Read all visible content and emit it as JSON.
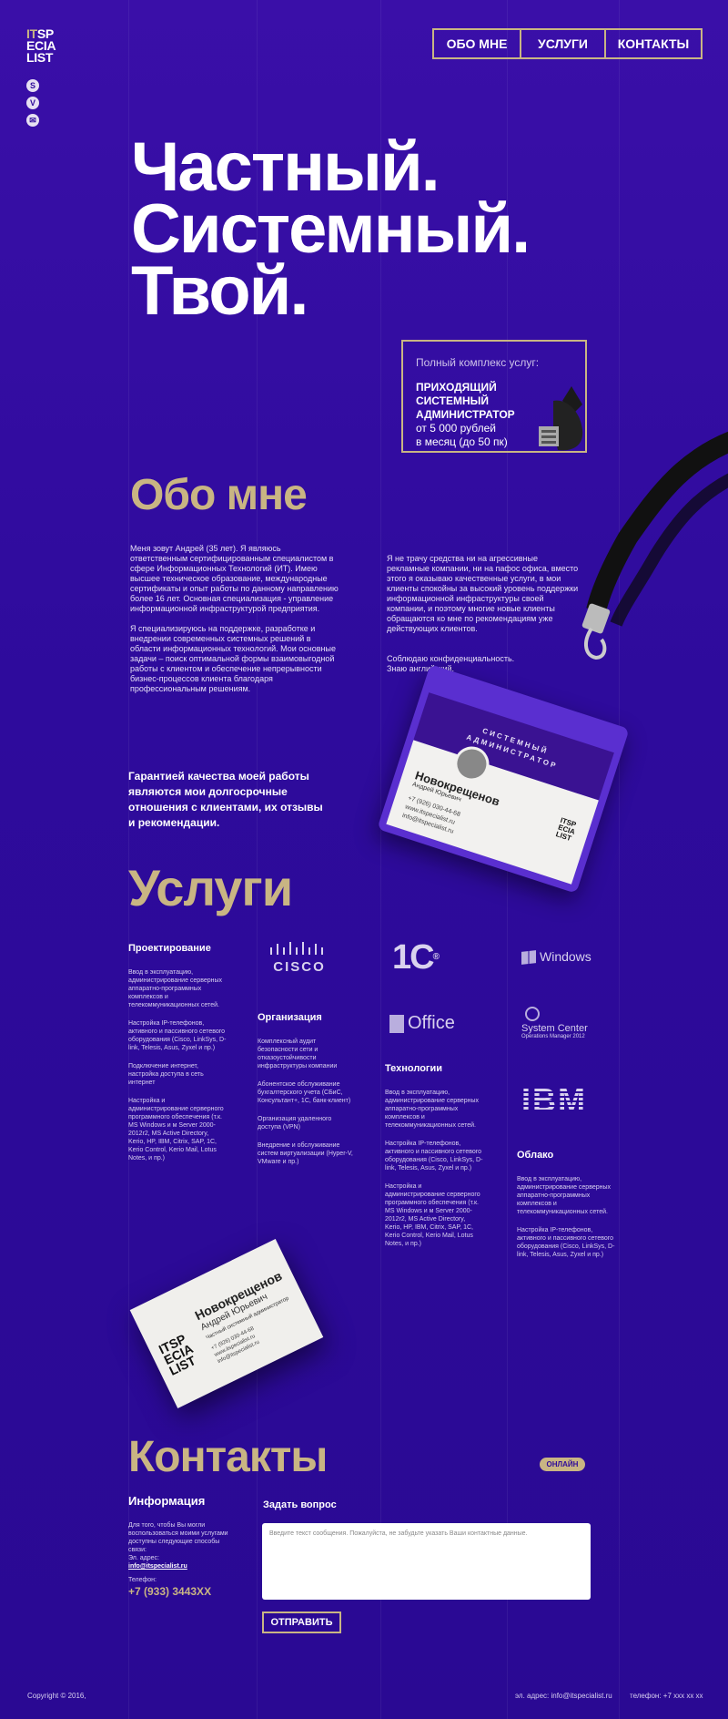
{
  "logo": {
    "line1_a": "IT",
    "line1_b": "SP",
    "line2": "ECIA",
    "line3": "LIST"
  },
  "social": [
    "S",
    "V",
    "✉"
  ],
  "nav": [
    "ОБО МНЕ",
    "УСЛУГИ",
    "КОНТАКТЫ"
  ],
  "hero": [
    "Частный.",
    "Системный.",
    "Твой."
  ],
  "offer": {
    "intro": "Полный комплекс услуг:",
    "title": "ПРИХОДЯЩИЙ СИСТЕМНЫЙ АДМИНИСТРАТОР",
    "price1": "от 5 000 рублей",
    "price2": "в месяц (до 50 пк)"
  },
  "about": {
    "title": "Обо мне",
    "col1": [
      "Меня зовут Андрей (35 лет). Я являюсь ответственным сертифицированным специалистом в сфере Информационных Технологий (ИТ). Имею высшее техническое образование, международные сертификаты и опыт работы по данному направлению более 16 лет. Основная специализация - управление информационной инфраструктурой предприятия.",
      "Я специализируюсь на поддержке, разработке и внедрении современных системных решений в области информационных технологий. Мои основные задачи – поиск оптимальной формы взаимовыгодной работы с клиентом и обеспечение непрерывности бизнес-процессов клиента благодаря профессиональным решениям."
    ],
    "col2": [
      "Я не трачу средства ни на агрессивные рекламные компании, ни на пафос офиса, вместо этого я оказываю качественные услуги, в мои клиенты спокойны за высокий уровень поддержки информационной инфраструктуры своей компании, и поэтому многие новые клиенты обращаются ко мне по рекомендациям уже действующих клиентов.",
      "Соблюдаю конфиденциальность.\nЗнаю английский."
    ],
    "quote": "Гарантией качества моей работы являются мои долгосрочные отношения с клиентами, их  отзывы и рекомендации."
  },
  "badge": {
    "role1": "СИСТЕМНЫЙ",
    "role2": "АДМИНИСТРАТОР",
    "name": "Новокрещенов",
    "sub": "Андрей Юрьевич",
    "phone": "+7 (926) 030-44-68",
    "site": "www.itspecialist.ru",
    "email": "info@itspecialist.ru",
    "mini": [
      "ITSP",
      "ECIA",
      "LIST"
    ]
  },
  "services": {
    "title": "Услуги",
    "design": {
      "title": "Проектирование",
      "items": [
        "Ввод в эксплуатацию, администрирование серверных аппаратно-программных комплексов и телекоммуникационных сетей.",
        "Настройка IP-телефонов, активного и пассивного сетевого оборудования (Cisco, LinkSys, D-link, Telesis, Asus, Zyxel и пр.)",
        "Подключение интернет, настройка доступа в сеть интернет",
        "Настройка и администрирование серверного программного обеспечения (т.к. MS Windows и м Server 2000-2012r2, MS Active Directory, Kerio, HP, IBM, Citrix, SAP, 1C, Kerio Control, Kerio Mail, Lotus Notes,  и пр.)"
      ]
    },
    "org": {
      "title": "Организация",
      "items": [
        "Комплексный аудит безопасности сети и отказоустойчивости инфраструктуры компании",
        "Абонентское обслуживание бухгалтерского учета (СБиС, Консультант+, 1С, банк-клиент)",
        "Организация удаленного доступа (VPN)",
        "Внедрение и обслуживание систем виртуализации (Hyper-V, VMware и пр.)"
      ]
    },
    "tech": {
      "title": "Технологии",
      "items": [
        "Ввод в эксплуатацию, администрирование серверных аппаратно-программных комплексов и телекоммуникационных сетей.",
        "Настройка IP-телефонов, активного и пассивного сетевого оборудования (Cisco, LinkSys, D-link, Telesis, Asus, Zyxel и пр.)",
        "Настройка и администрирование серверного программного обеспечения (т.к. MS Windows и м Server 2000-2012r2, MS Active Directory, Kerio, HP, IBM, Citrix, SAP, 1C, Kerio Control, Kerio Mail, Lotus Notes,  и пр.)"
      ]
    },
    "cloud": {
      "title": "Облако",
      "items": [
        "Ввод в эксплуатацию, администрирование серверных аппаратно-программных комплексов и телекоммуникационных сетей.",
        "Настройка IP-телефонов, активного и пассивного сетевого оборудования (Cisco, LinkSys, D-link, Telesis, Asus, Zyxel и пр.)"
      ]
    },
    "brands": {
      "cisco": "CISCO",
      "onec": "1С",
      "windows": "Windows",
      "office": "Office",
      "sc1": "System Center",
      "sc2": "Operations Manager 2012",
      "ibm": "IBM"
    }
  },
  "bcard": {
    "logo": [
      "ITSP",
      "ECIA",
      "LIST"
    ],
    "name": "Новокрещенов",
    "sub": "Андрей Юрьевич",
    "title": "Частный системный администратор",
    "phone": "+7 (926) 030-44-68",
    "site": "www.itspecialist.ru",
    "email": "info@itspecialist.ru"
  },
  "contacts": {
    "title": "Контакты",
    "online": "ОНЛАЙН",
    "info_title": "Информация",
    "info_text": "Для того, чтобы Вы могли воспользоваться моими услугами доступны следующие способы связи:",
    "email_label": "Эл. адрес:",
    "email": "info@itspecialist.ru",
    "phone_label": "Телефон:",
    "phone": "+7 (933) 3443XX",
    "ask_title": "Задать вопрос",
    "ask_placeholder": "Введите текст сообщения. Пожалуйста, не забудьте указать Ваши контактные данные.",
    "send": "ОТПРАВИТЬ"
  },
  "footer": {
    "copyright": "Copyright © 2016,",
    "email": "эл. адрес: info@itspecialist.ru",
    "phone": "телефон: +7 xxx xx xx"
  },
  "colors": {
    "bg": "#2e0a9a",
    "accent": "#c9b583"
  }
}
